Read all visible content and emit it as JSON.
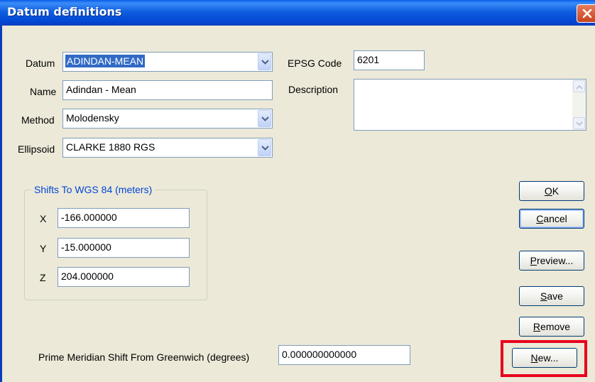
{
  "window": {
    "title": "Datum definitions"
  },
  "datum": {
    "label": "Datum",
    "value": "ADINDAN-MEAN"
  },
  "name": {
    "label": "Name",
    "value": "Adindan - Mean"
  },
  "method": {
    "label": "Method",
    "value": "Molodensky"
  },
  "ellipsoid": {
    "label": "Ellipsoid",
    "value": "CLARKE 1880 RGS"
  },
  "epsg": {
    "label": "EPSG Code",
    "value": "6201"
  },
  "description": {
    "label": "Description",
    "value": ""
  },
  "shifts": {
    "title": "Shifts To WGS 84 (meters)",
    "x": {
      "label": "X",
      "value": "-166.000000"
    },
    "y": {
      "label": "Y",
      "value": "-15.000000"
    },
    "z": {
      "label": "Z",
      "value": "204.000000"
    }
  },
  "prime_meridian": {
    "label": "Prime Meridian Shift From Greenwich (degrees)",
    "value": "0.000000000000"
  },
  "buttons": {
    "ok": {
      "mnemonic": "O",
      "rest": "K"
    },
    "cancel": {
      "mnemonic": "C",
      "rest": "ancel"
    },
    "preview": {
      "mnemonic": "P",
      "rest": "review..."
    },
    "save": {
      "mnemonic": "S",
      "rest": "ave"
    },
    "remove": {
      "mnemonic": "R",
      "rest": "emove"
    },
    "new": {
      "mnemonic": "N",
      "rest": "ew..."
    }
  },
  "icons": {
    "close": "close-icon",
    "dropdown": "chevron-down-icon",
    "scroll_up": "arrow-up-icon",
    "scroll_down": "arrow-down-icon"
  },
  "colors": {
    "titlebar": "#0a5ee8",
    "face": "#ece9d8",
    "group_title": "#0046d5",
    "selection": "#316ac5",
    "highlight": "#e8001c"
  }
}
